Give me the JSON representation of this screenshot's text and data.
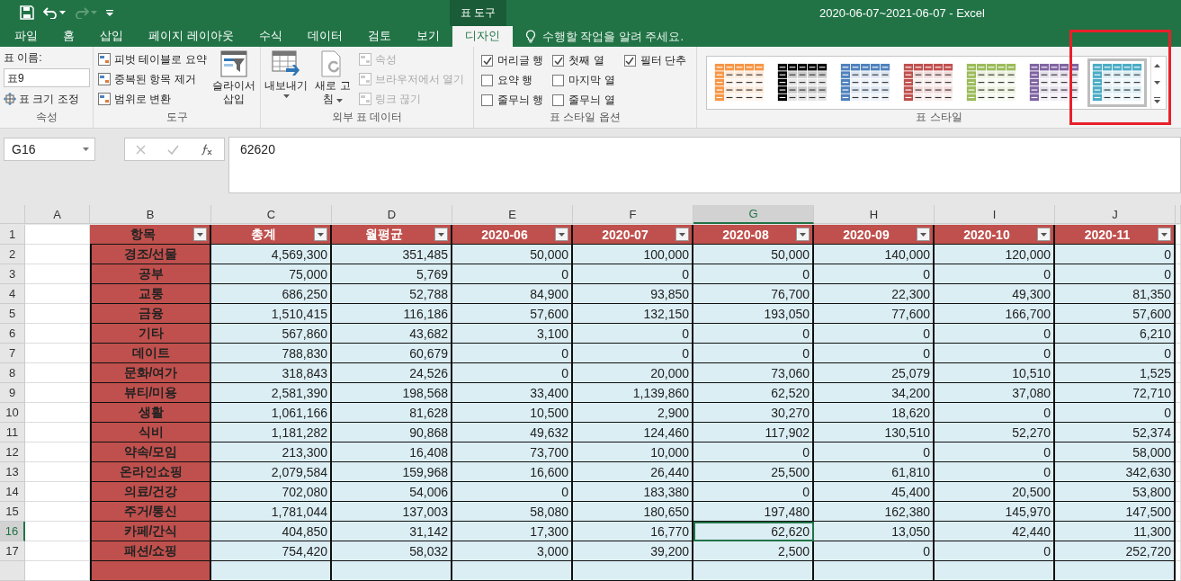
{
  "window": {
    "title": "2020-06-07~2021-06-07 - Excel",
    "context_label": "표 도구"
  },
  "tabs": [
    {
      "label": "파일",
      "selected": false
    },
    {
      "label": "홈",
      "selected": false
    },
    {
      "label": "삽입",
      "selected": false
    },
    {
      "label": "페이지 레이아웃",
      "selected": false
    },
    {
      "label": "수식",
      "selected": false
    },
    {
      "label": "데이터",
      "selected": false
    },
    {
      "label": "검토",
      "selected": false
    },
    {
      "label": "보기",
      "selected": false
    },
    {
      "label": "디자인",
      "selected": true
    }
  ],
  "tell_me": {
    "placeholder": "수행할 작업을 알려 주세요."
  },
  "ribbon": {
    "properties": {
      "label": "속성",
      "name_label": "표 이름:",
      "name_value": "표9",
      "resize": "표 크기 조정"
    },
    "tools": {
      "label": "도구",
      "items": [
        "피벗 테이블로 요약",
        "중복된 항목 제거",
        "범위로 변환"
      ],
      "slicer": "슬라이서 삽입"
    },
    "external": {
      "label": "외부 표 데이터",
      "export": "내보내기",
      "refresh": "새로 고침",
      "items": [
        {
          "label": "속성",
          "disabled": true
        },
        {
          "label": "브라우저에서 열기",
          "disabled": true
        },
        {
          "label": "링크 끊기",
          "disabled": true
        }
      ]
    },
    "options": {
      "label": "표 스타일 옵션",
      "checkboxes": [
        {
          "label": "머리글 행",
          "checked": true
        },
        {
          "label": "요약 행",
          "checked": false
        },
        {
          "label": "줄무늬 행",
          "checked": false
        },
        {
          "label": "첫째 열",
          "checked": true
        },
        {
          "label": "마지막 열",
          "checked": false
        },
        {
          "label": "줄무늬 열",
          "checked": false
        },
        {
          "label": "필터 단추",
          "checked": true
        }
      ]
    },
    "styles": {
      "label": "표 스타일",
      "highlight_box": true,
      "swatches": [
        {
          "color": "#f79646",
          "selected": false
        },
        {
          "color": "#000000",
          "selected": false
        },
        {
          "color": "#4f81bd",
          "selected": false
        },
        {
          "color": "#c0504d",
          "selected": false
        },
        {
          "color": "#9bbb59",
          "selected": false
        },
        {
          "color": "#8064a2",
          "selected": false
        },
        {
          "color": "#4bacc6",
          "selected": true
        }
      ]
    }
  },
  "formula_bar": {
    "name_box": "G16",
    "value": "62620"
  },
  "sheet": {
    "columns": [
      {
        "letter": "A",
        "selected": false
      },
      {
        "letter": "B",
        "selected": false
      },
      {
        "letter": "C",
        "selected": false
      },
      {
        "letter": "D",
        "selected": false
      },
      {
        "letter": "E",
        "selected": false
      },
      {
        "letter": "F",
        "selected": false
      },
      {
        "letter": "G",
        "selected": true
      },
      {
        "letter": "H",
        "selected": false
      },
      {
        "letter": "I",
        "selected": false
      },
      {
        "letter": "J",
        "selected": false
      }
    ],
    "header_row": {
      "number": "1",
      "cells": [
        "항목",
        "총계",
        "월평균",
        "2020-06",
        "2020-07",
        "2020-08",
        "2020-09",
        "2020-10",
        "2020-11"
      ]
    },
    "rows": [
      {
        "number": "2",
        "selected": false,
        "label": "경조/선물",
        "values": [
          "4,569,300",
          "351,485",
          "50,000",
          "100,000",
          "50,000",
          "140,000",
          "120,000",
          "0"
        ]
      },
      {
        "number": "3",
        "selected": false,
        "label": "공부",
        "values": [
          "75,000",
          "5,769",
          "0",
          "0",
          "0",
          "0",
          "0",
          "0"
        ]
      },
      {
        "number": "4",
        "selected": false,
        "label": "교통",
        "values": [
          "686,250",
          "52,788",
          "84,900",
          "93,850",
          "76,700",
          "22,300",
          "49,300",
          "81,350"
        ]
      },
      {
        "number": "5",
        "selected": false,
        "label": "금융",
        "values": [
          "1,510,415",
          "116,186",
          "57,600",
          "132,150",
          "193,050",
          "77,600",
          "166,700",
          "57,600"
        ]
      },
      {
        "number": "6",
        "selected": false,
        "label": "기타",
        "values": [
          "567,860",
          "43,682",
          "3,100",
          "0",
          "0",
          "0",
          "0",
          "6,210"
        ]
      },
      {
        "number": "7",
        "selected": false,
        "label": "데이트",
        "values": [
          "788,830",
          "60,679",
          "0",
          "0",
          "0",
          "0",
          "0",
          "0"
        ]
      },
      {
        "number": "8",
        "selected": false,
        "label": "문화/여가",
        "values": [
          "318,843",
          "24,526",
          "0",
          "20,000",
          "73,060",
          "25,079",
          "10,510",
          "1,525"
        ]
      },
      {
        "number": "9",
        "selected": false,
        "label": "뷰티/미용",
        "values": [
          "2,581,390",
          "198,568",
          "33,400",
          "1,139,860",
          "62,520",
          "34,200",
          "37,080",
          "72,710"
        ]
      },
      {
        "number": "10",
        "selected": false,
        "label": "생활",
        "values": [
          "1,061,166",
          "81,628",
          "10,500",
          "2,900",
          "30,270",
          "18,620",
          "0",
          "0"
        ]
      },
      {
        "number": "11",
        "selected": false,
        "label": "식비",
        "values": [
          "1,181,282",
          "90,868",
          "49,632",
          "124,460",
          "117,902",
          "130,510",
          "52,270",
          "52,374"
        ]
      },
      {
        "number": "12",
        "selected": false,
        "label": "약속/모임",
        "values": [
          "213,300",
          "16,408",
          "73,700",
          "10,000",
          "0",
          "0",
          "0",
          "58,000"
        ]
      },
      {
        "number": "13",
        "selected": false,
        "label": "온라인쇼핑",
        "values": [
          "2,079,584",
          "159,968",
          "16,600",
          "26,440",
          "25,500",
          "61,810",
          "0",
          "342,630"
        ]
      },
      {
        "number": "14",
        "selected": false,
        "label": "의료/건강",
        "values": [
          "702,080",
          "54,006",
          "0",
          "183,380",
          "0",
          "45,400",
          "20,500",
          "53,800"
        ]
      },
      {
        "number": "15",
        "selected": false,
        "label": "주거/통신",
        "values": [
          "1,781,044",
          "137,003",
          "58,080",
          "180,650",
          "197,480",
          "162,380",
          "145,970",
          "147,500"
        ]
      },
      {
        "number": "16",
        "selected": true,
        "label": "카페/간식",
        "values": [
          "404,850",
          "31,142",
          "17,300",
          "16,770",
          "62,620",
          "13,050",
          "42,440",
          "11,300"
        ]
      },
      {
        "number": "17",
        "selected": false,
        "label": "패션/쇼핑",
        "values": [
          "754,420",
          "58,032",
          "3,000",
          "39,200",
          "2,500",
          "0",
          "0",
          "252,720"
        ]
      }
    ]
  }
}
